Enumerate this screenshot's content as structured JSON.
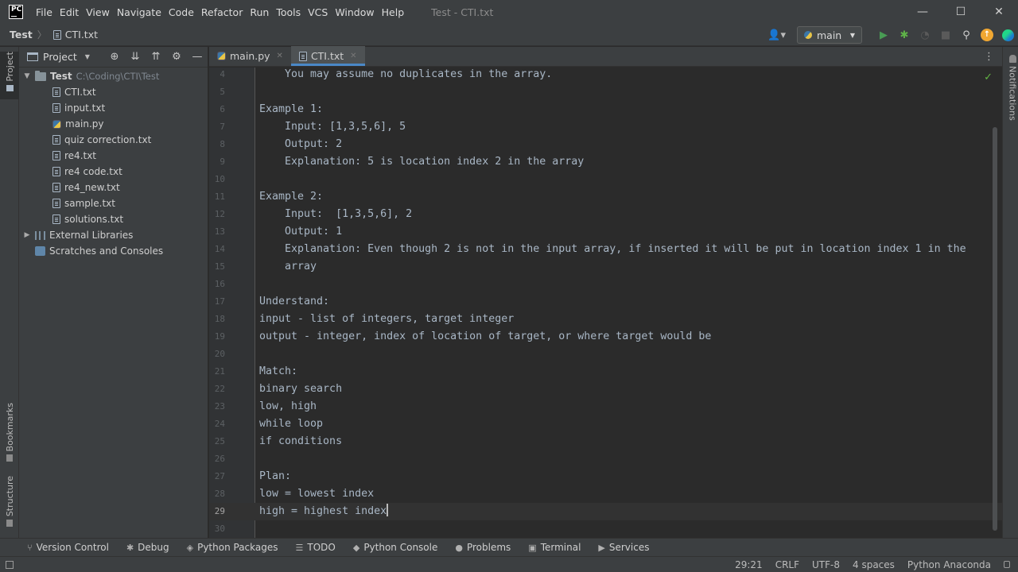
{
  "menu": [
    "File",
    "Edit",
    "View",
    "Navigate",
    "Code",
    "Refactor",
    "Run",
    "Tools",
    "VCS",
    "Window",
    "Help"
  ],
  "window_title": "Test - CTI.txt",
  "app_logo": "PC",
  "window_controls": {
    "minimize": "—",
    "maximize": "☐",
    "close": "✕"
  },
  "navbar": {
    "project": "Test",
    "separator": "〉",
    "file": "CTI.txt",
    "branch": "main",
    "icons": [
      "user-icon",
      "run-icon",
      "debug-icon",
      "profile-icon",
      "stop-icon",
      "search-icon",
      "update-icon",
      "ide-logo-icon"
    ]
  },
  "project_panel": {
    "title": "Project",
    "root": {
      "name": "Test",
      "path": "C:\\Coding\\CTI\\Test"
    },
    "files": [
      {
        "name": "CTI.txt",
        "type": "text"
      },
      {
        "name": "input.txt",
        "type": "text"
      },
      {
        "name": "main.py",
        "type": "python"
      },
      {
        "name": "quiz correction.txt",
        "type": "text"
      },
      {
        "name": "re4.txt",
        "type": "text"
      },
      {
        "name": "re4 code.txt",
        "type": "text"
      },
      {
        "name": "re4_new.txt",
        "type": "text"
      },
      {
        "name": "sample.txt",
        "type": "text"
      },
      {
        "name": "solutions.txt",
        "type": "text"
      }
    ],
    "external_libraries": "External Libraries",
    "scratches": "Scratches and Consoles"
  },
  "tabs": [
    {
      "label": "main.py",
      "type": "python",
      "active": false
    },
    {
      "label": "CTI.txt",
      "type": "text",
      "active": true
    }
  ],
  "editor": {
    "current_line": 29,
    "lines": [
      {
        "n": "4",
        "text": "    You may assume no duplicates in the array."
      },
      {
        "n": "5",
        "text": ""
      },
      {
        "n": "6",
        "text": "Example 1:"
      },
      {
        "n": "7",
        "text": "    Input: [1,3,5,6], 5"
      },
      {
        "n": "8",
        "text": "    Output: 2"
      },
      {
        "n": "9",
        "text": "    Explanation: 5 is location index 2 in the array"
      },
      {
        "n": "10",
        "text": ""
      },
      {
        "n": "11",
        "text": "Example 2:"
      },
      {
        "n": "12",
        "text": "    Input:  [1,3,5,6], 2"
      },
      {
        "n": "13",
        "text": "    Output: 1"
      },
      {
        "n": "14",
        "text": "    Explanation: Even though 2 is not in the input array, if inserted it will be put in location index 1 in the"
      },
      {
        "n": "15",
        "text": "    array"
      },
      {
        "n": "16",
        "text": ""
      },
      {
        "n": "17",
        "text": "Understand:"
      },
      {
        "n": "18",
        "text": "input - list of integers, target integer"
      },
      {
        "n": "19",
        "text": "output - integer, index of location of target, or where target would be"
      },
      {
        "n": "20",
        "text": ""
      },
      {
        "n": "21",
        "text": "Match:"
      },
      {
        "n": "22",
        "text": "binary search"
      },
      {
        "n": "23",
        "text": "low, high"
      },
      {
        "n": "24",
        "text": "while loop"
      },
      {
        "n": "25",
        "text": "if conditions"
      },
      {
        "n": "26",
        "text": ""
      },
      {
        "n": "27",
        "text": "Plan:"
      },
      {
        "n": "28",
        "text": "low = lowest index"
      },
      {
        "n": "29",
        "text": "high = highest index"
      },
      {
        "n": "30",
        "text": ""
      }
    ]
  },
  "left_strip": {
    "project": "Project",
    "bookmarks": "Bookmarks",
    "structure": "Structure"
  },
  "right_strip": {
    "notifications": "Notifications"
  },
  "tool_windows": [
    {
      "label": "Version Control",
      "icon": "version-control-icon",
      "glyph": "⑂"
    },
    {
      "label": "Debug",
      "icon": "debug-icon",
      "glyph": "✱"
    },
    {
      "label": "Python Packages",
      "icon": "packages-icon",
      "glyph": "◈"
    },
    {
      "label": "TODO",
      "icon": "todo-icon",
      "glyph": "☰"
    },
    {
      "label": "Python Console",
      "icon": "python-console-icon",
      "glyph": "◆"
    },
    {
      "label": "Problems",
      "icon": "problems-icon",
      "glyph": "●"
    },
    {
      "label": "Terminal",
      "icon": "terminal-icon",
      "glyph": "▣"
    },
    {
      "label": "Services",
      "icon": "services-icon",
      "glyph": "▶"
    }
  ],
  "status": {
    "position": "29:21",
    "line_separator": "CRLF",
    "encoding": "UTF-8",
    "indent": "4 spaces",
    "interpreter": "Python Anaconda"
  },
  "colors": {
    "accent": "#4a88c7",
    "run": "#499c54",
    "background": "#2b2b2b",
    "panel": "#3c3f41"
  }
}
